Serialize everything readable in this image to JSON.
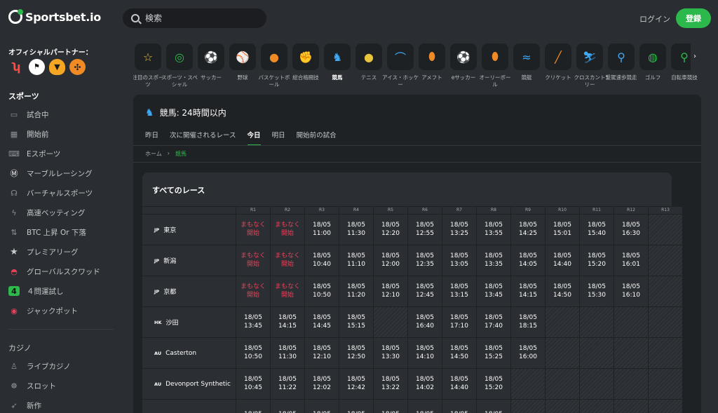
{
  "header": {
    "logo_text": "Sportsbet.io",
    "search_placeholder": "検索",
    "login_label": "ログイン",
    "register_label": "登録"
  },
  "sidebar": {
    "partner_title": "オフィシャルパートナー：",
    "sports_title": "スポーツ",
    "sports_items": [
      {
        "label": "試合中",
        "icon": "monitor-icon"
      },
      {
        "label": "開始前",
        "icon": "calendar-icon"
      },
      {
        "label": "Eスポーツ",
        "icon": "gamepad-icon"
      },
      {
        "label": "マーブルレーシング",
        "icon": "marble-icon"
      },
      {
        "label": "バーチャルスポーツ",
        "icon": "headset-icon"
      },
      {
        "label": "高速ベッティング",
        "icon": "lightning-icon"
      },
      {
        "label": "BTC 上昇 Or 下落",
        "icon": "arrows-icon"
      },
      {
        "label": "プレミアリーグ",
        "icon": "star-icon"
      },
      {
        "label": "グローバルスクワッド",
        "icon": "squad-icon"
      },
      {
        "label": "４問運試し",
        "icon": "four-icon"
      },
      {
        "label": "ジャックポット",
        "icon": "jackpot-icon"
      }
    ],
    "casino_title": "カジノ",
    "casino_items": [
      {
        "label": "ライブカジノ",
        "icon": "dealer-icon"
      },
      {
        "label": "スロット",
        "icon": "slot-icon"
      },
      {
        "label": "新作",
        "icon": "rocket-icon"
      }
    ]
  },
  "categories": [
    {
      "label": "注目のスポーツ",
      "icon": "star-icon",
      "glyph": "☆",
      "color": "#e8c53a"
    },
    {
      "label": "スポーツ・スペシャル",
      "icon": "special-icon",
      "glyph": "◎",
      "color": "#2db84b"
    },
    {
      "label": "サッカー",
      "icon": "soccer-icon",
      "glyph": "⚽",
      "color": "#e8425b"
    },
    {
      "label": "野球",
      "icon": "baseball-icon",
      "glyph": "⚾",
      "color": "#d0d0d0"
    },
    {
      "label": "バスケットボール",
      "icon": "basketball-icon",
      "glyph": "●",
      "color": "#f08a24"
    },
    {
      "label": "総合格闘技",
      "icon": "glove-icon",
      "glyph": "✊",
      "color": "#d0d0d0"
    },
    {
      "label": "競馬",
      "icon": "horse-icon",
      "glyph": "♞",
      "color": "#3fa9f5"
    },
    {
      "label": "テニス",
      "icon": "tennis-icon",
      "glyph": "●",
      "color": "#e8c53a"
    },
    {
      "label": "アイス・ホッケー",
      "icon": "hockey-icon",
      "glyph": "⌒",
      "color": "#3fa9f5"
    },
    {
      "label": "アメフト",
      "icon": "football-icon",
      "glyph": "⬮",
      "color": "#f08a24"
    },
    {
      "label": "eサッカー",
      "icon": "esoccer-icon",
      "glyph": "⚽",
      "color": "#e8425b"
    },
    {
      "label": "オーリーボール",
      "icon": "rugby-icon",
      "glyph": "⬮",
      "color": "#f08a24"
    },
    {
      "label": "競艇",
      "icon": "boat-icon",
      "glyph": "≈",
      "color": "#3fa9f5"
    },
    {
      "label": "クリケット",
      "icon": "cricket-icon",
      "glyph": "╱",
      "color": "#f08a24"
    },
    {
      "label": "クロスカントリー",
      "icon": "ski-icon",
      "glyph": "⛷",
      "color": "#3fa9f5"
    },
    {
      "label": "繋駕速歩競走",
      "icon": "harness-icon",
      "glyph": "⚲",
      "color": "#3fa9f5"
    },
    {
      "label": "ゴルフ",
      "icon": "golf-icon",
      "glyph": "◍",
      "color": "#2db84b"
    },
    {
      "label": "自転車競技",
      "icon": "cycling-icon",
      "glyph": "⚲",
      "color": "#2db84b"
    }
  ],
  "panel": {
    "title": "競馬: 24時間以内",
    "tabs": [
      "昨日",
      "次に開催されるレース",
      "今日",
      "明日",
      "開始前の試合"
    ],
    "active_tab": 2,
    "breadcrumb": [
      "ホーム",
      "競馬"
    ],
    "races_title": "すべてのレース",
    "columns": [
      "R1",
      "R2",
      "R3",
      "R4",
      "R5",
      "R6",
      "R7",
      "R8",
      "R9",
      "R10",
      "R11",
      "R12",
      "R13"
    ],
    "rows": [
      {
        "cc": "JP",
        "name": "東京",
        "cells": [
          "まもなく 開始",
          "まもなく 開始",
          "18/05 11:00",
          "18/05 11:30",
          "18/05 12:20",
          "18/05 12:55",
          "18/05 13:25",
          "18/05 13:55",
          "18/05 14:25",
          "18/05 15:01",
          "18/05 15:40",
          "18/05 16:30",
          ""
        ]
      },
      {
        "cc": "JP",
        "name": "新潟",
        "cells": [
          "まもなく 開始",
          "まもなく 開始",
          "18/05 10:40",
          "18/05 11:10",
          "18/05 12:00",
          "18/05 12:35",
          "18/05 13:05",
          "18/05 13:35",
          "18/05 14:05",
          "18/05 14:40",
          "18/05 15:20",
          "18/05 16:01",
          ""
        ]
      },
      {
        "cc": "JP",
        "name": "京都",
        "cells": [
          "まもなく 開始",
          "まもなく 開始",
          "18/05 10:50",
          "18/05 11:20",
          "18/05 12:10",
          "18/05 12:45",
          "18/05 13:15",
          "18/05 13:45",
          "18/05 14:15",
          "18/05 14:50",
          "18/05 15:30",
          "18/05 16:10",
          ""
        ]
      },
      {
        "cc": "HK",
        "name": "沙田",
        "cells": [
          "18/05 13:45",
          "18/05 14:15",
          "18/05 14:45",
          "18/05 15:15",
          "",
          "18/05 16:40",
          "18/05 17:10",
          "18/05 17:40",
          "18/05 18:15",
          "",
          "",
          "",
          ""
        ]
      },
      {
        "cc": "AU",
        "name": "Casterton",
        "cells": [
          "18/05 10:50",
          "18/05 11:30",
          "18/05 12:10",
          "18/05 12:50",
          "18/05 13:30",
          "18/05 14:10",
          "18/05 14:50",
          "18/05 15:25",
          "18/05 16:00",
          "",
          "",
          "",
          ""
        ]
      },
      {
        "cc": "AU",
        "name": "Devonport Synthetic",
        "cells": [
          "18/05 10:45",
          "18/05 11:22",
          "18/05 12:02",
          "18/05 12:42",
          "18/05 13:22",
          "18/05 14:02",
          "18/05 14:40",
          "18/05 15:20",
          "",
          "",
          "",
          "",
          ""
        ]
      },
      {
        "cc": "",
        "name": "",
        "cells": [
          "18/05",
          "18/05",
          "18/05",
          "18/05",
          "18/05",
          "18/05",
          "18/05",
          "18/05",
          "",
          "",
          "",
          "",
          ""
        ]
      }
    ]
  },
  "colors": {
    "accent_green": "#2db84b",
    "soon_red": "#e8425b",
    "horse_blue": "#3fa9f5"
  }
}
